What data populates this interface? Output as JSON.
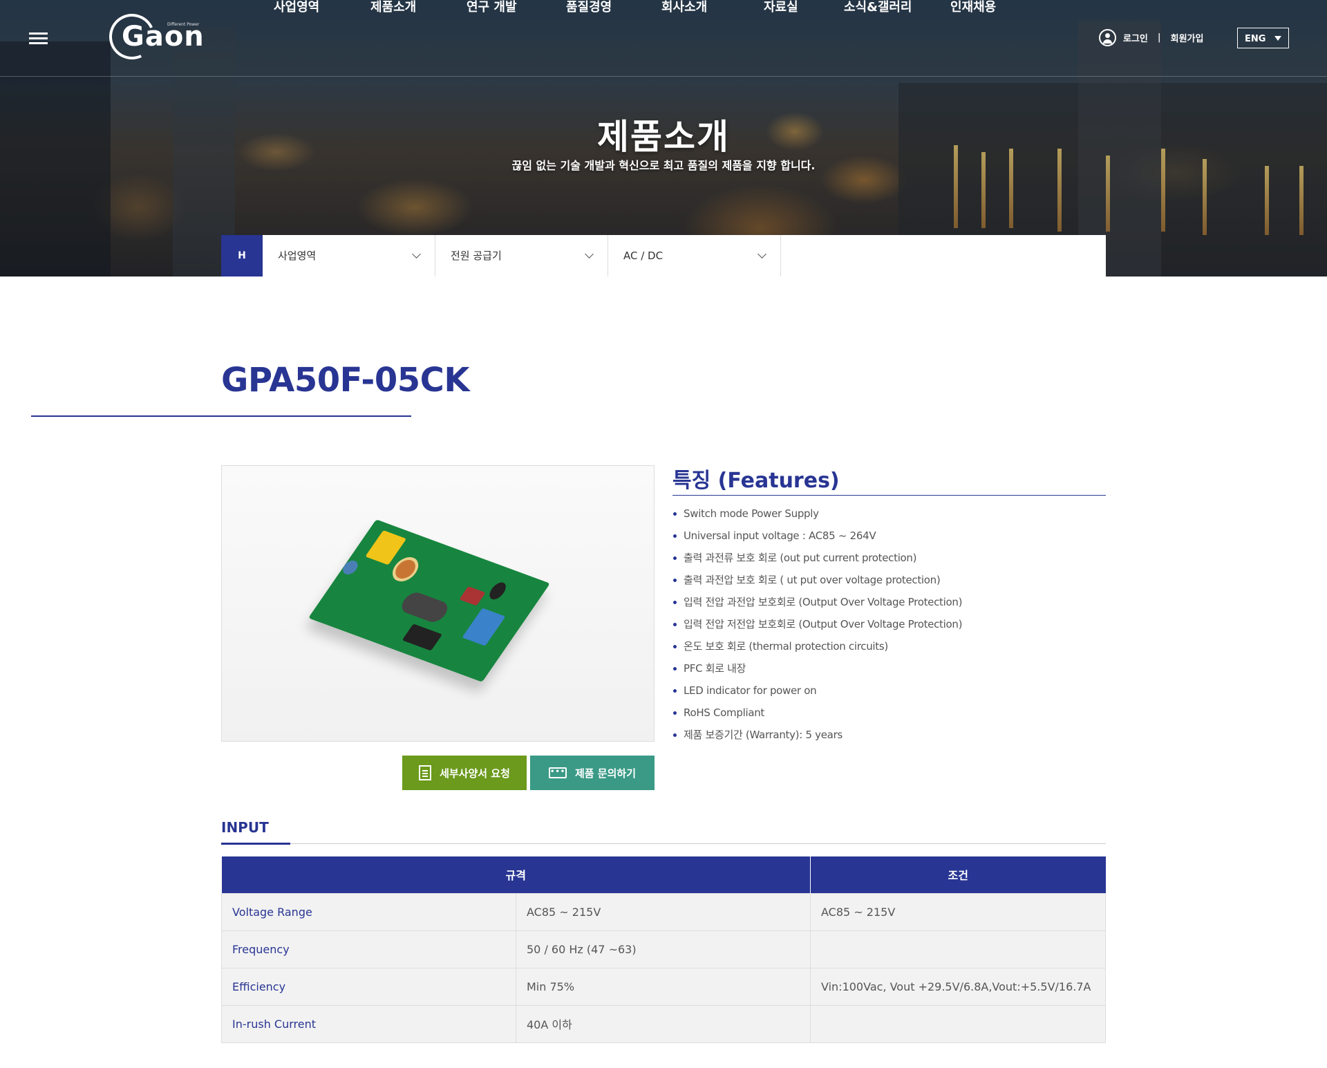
{
  "header": {
    "logo_text": "Gaon",
    "logo_tagline": "Different Power",
    "nav": [
      "사업영역",
      "제품소개",
      "연구 개발",
      "품질경영",
      "회사소개",
      "자료실",
      "소식&갤러리",
      "인재채용"
    ],
    "login_label": "로그인",
    "separator": "|",
    "signup_label": "회원가입",
    "lang_label": "ENG"
  },
  "hero": {
    "title": "제품소개",
    "subtitle": "끊임 없는 기술 개발과 혁신으로 최고 품질의 제품을 지향 합니다."
  },
  "breadcrumb": {
    "home_label": "H",
    "items": [
      "사업영역",
      "전원 공급기",
      "AC / DC"
    ]
  },
  "product": {
    "model": "GPA50F-05CK",
    "spec_request_label": "세부사양서 요청",
    "inquiry_label": "제품 문의하기",
    "chat_icon_glyph": "•••"
  },
  "features": {
    "title": "특징 (Features)",
    "items": [
      "Switch mode Power Supply",
      "Universal input voltage : AC85 ~ 264V",
      "출력 과전류 보호 회로 (out put current protection)",
      "출력 과전압 보호 회로 ( ut put over voltage protection)",
      "입력 전압 과전압 보호회로 (Output Over Voltage Protection)",
      "입력 전압 저전압 보호회로 (Output Over Voltage Protection)",
      "온도 보호 회로 (thermal protection circuits)",
      "PFC 회로 내장",
      "LED indicator for power on",
      "RoHS Compliant",
      "제품 보증기간 (Warranty): 5 years"
    ]
  },
  "input_section": {
    "title": "INPUT",
    "headers": [
      "규격",
      "조건"
    ],
    "rows": [
      {
        "label": "Voltage Range",
        "spec": "AC85 ~ 215V",
        "condition": "AC85 ~ 215V"
      },
      {
        "label": "Frequency",
        "spec": "50 / 60 Hz (47 ~63)",
        "condition": ""
      },
      {
        "label": "Efficiency",
        "spec": "Min 75%",
        "condition": "Vin:100Vac, Vout +29.5V/6.8A,Vout:+5.5V/16.7A"
      },
      {
        "label": "In-rush Current",
        "spec": "40A 이하",
        "condition": ""
      }
    ]
  },
  "colors": {
    "brand_navy": "#283593",
    "spec_button": "#6b9a1c",
    "inquiry_button": "#3a9a86"
  }
}
